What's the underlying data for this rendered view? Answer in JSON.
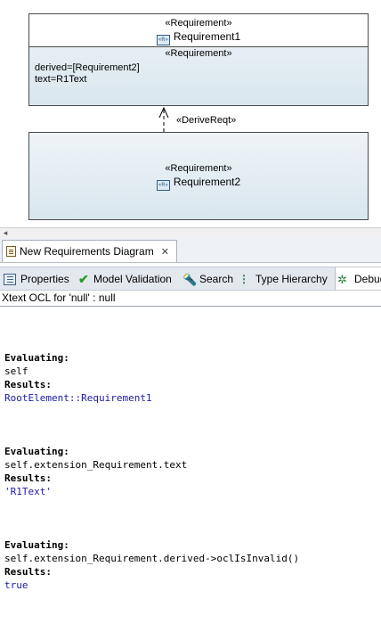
{
  "diagram": {
    "requirement1": {
      "stereotype": "«Requirement»",
      "icon": "requirement-icon",
      "icon_text": "«R»",
      "name": "Requirement1",
      "section_stereotype": "«Requirement»",
      "attributes": [
        "derived=[Requirement2]",
        "text=R1Text"
      ]
    },
    "relation": {
      "label": "«DeriveReqt»"
    },
    "requirement2": {
      "stereotype": "«Requirement»",
      "icon": "requirement-icon",
      "icon_text": "«R»",
      "name": "Requirement2"
    }
  },
  "scrollbar": {
    "left_arrow": "◂"
  },
  "editor": {
    "tab_label": "New Requirements Diagram",
    "tab_icon": "diagram-icon",
    "close_glyph": "✕"
  },
  "views": {
    "tabs": [
      {
        "label": "Properties",
        "icon": "properties-icon"
      },
      {
        "label": "Model Validation",
        "icon": "check-icon"
      },
      {
        "label": "Search",
        "icon": "search-icon"
      },
      {
        "label": "Type Hierarchy",
        "icon": "hierarchy-icon"
      },
      {
        "label": "Debug",
        "icon": "debug-icon"
      }
    ]
  },
  "console": {
    "title": "Xtext OCL for 'null' : null",
    "entries": [
      {
        "evaluating_label": "Evaluating:",
        "expression": "self",
        "results_label": "Results:",
        "result": "RootElement::Requirement1"
      },
      {
        "evaluating_label": "Evaluating:",
        "expression": "self.extension_Requirement.text",
        "results_label": "Results:",
        "result": "'R1Text'"
      },
      {
        "evaluating_label": "Evaluating:",
        "expression": "self.extension_Requirement.derived->oclIsInvalid()",
        "results_label": "Results:",
        "result": "true"
      }
    ]
  },
  "colors": {
    "result_text": "#1a1aa6",
    "box_fill": "#d9e6ee",
    "border": "#4a4a4a"
  }
}
